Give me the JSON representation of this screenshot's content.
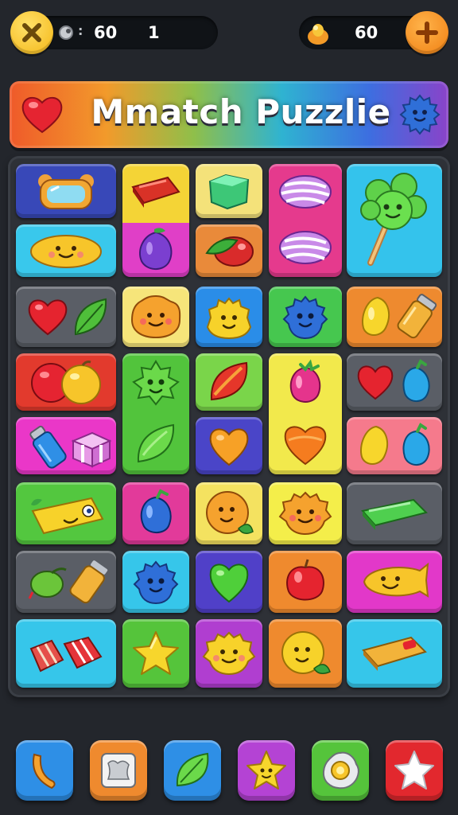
{
  "hud": {
    "left_value": "60",
    "left_sub_value": "1",
    "left_sep": ":",
    "right_value": "60"
  },
  "banner": {
    "title": "Mmatch Puzzlie"
  },
  "colors": {
    "background": "#23262c",
    "board": "#2e3137"
  },
  "tiles": [
    {
      "id": "t1",
      "color": "#3848b8",
      "icon": "mirror-frame-icon"
    },
    {
      "id": "t2",
      "color": "#f4d436",
      "icon": "red-candy-bar-icon"
    },
    {
      "id": "t3",
      "color": "#f4e27a",
      "icon": "green-gummy-block-icon"
    },
    {
      "id": "t4",
      "color": "#e53a8d",
      "icon": "striped-candy-pair-icon"
    },
    {
      "id": "t5",
      "color": "#34c3ec",
      "icon": "green-lollipop-face-icon"
    },
    {
      "id": "t6",
      "color": "#39c8ec",
      "icon": "yellow-smile-blob-icon"
    },
    {
      "id": "t7",
      "color": "#e03fc7",
      "icon": "purple-plum-icon"
    },
    {
      "id": "t8",
      "color": "#e98a3a",
      "icon": "green-red-berry-icon"
    },
    {
      "id": "t9",
      "color": "#5a5e66",
      "icon": "heart-and-leaf-icon"
    },
    {
      "id": "t10",
      "color": "#f6e57a",
      "icon": "orange-face-blob-icon"
    },
    {
      "id": "t11",
      "color": "#2a8de8",
      "icon": "yellow-face-blob-icon"
    },
    {
      "id": "t12",
      "color": "#46c74f",
      "icon": "blue-face-blob-icon"
    },
    {
      "id": "t13",
      "color": "#ee8a2f",
      "icon": "lemon-and-pencil-icon"
    },
    {
      "id": "t14",
      "color": "#e23a2d",
      "icon": "red-and-yellow-balls-icon"
    },
    {
      "id": "t15",
      "color": "#52c43c",
      "icon": "green-smile-blob-and-leaf-icon"
    },
    {
      "id": "t16",
      "color": "#7ad54a",
      "icon": "red-leaf-icon"
    },
    {
      "id": "t17",
      "color": "#f2e94c",
      "icon": "pink-berry-and-orange-heart-icon"
    },
    {
      "id": "t18",
      "color": "#5a5e66",
      "icon": "heart-and-blue-berry-icon"
    },
    {
      "id": "t19",
      "color": "#ea37c8",
      "icon": "glue-and-giftbox-icon"
    },
    {
      "id": "t20",
      "color": "#4a45c8",
      "icon": "orange-heart-icon"
    },
    {
      "id": "t21",
      "color": "#f57a8c",
      "icon": "lemon-and-blue-berry-icon"
    },
    {
      "id": "t22",
      "color": "#53c73f",
      "icon": "cheese-face-icon"
    },
    {
      "id": "t23",
      "color": "#e23a9a",
      "icon": "blue-berry-icon"
    },
    {
      "id": "t24",
      "color": "#f4e260",
      "icon": "orange-ball-face-icon"
    },
    {
      "id": "t25",
      "color": "#f4ee4a",
      "icon": "orange-fluffy-face-icon"
    },
    {
      "id": "t26",
      "color": "#5a5e66",
      "icon": "green-candy-bar-icon"
    },
    {
      "id": "t27",
      "color": "#5a5e66",
      "icon": "olive-and-glue-icon"
    },
    {
      "id": "t28",
      "color": "#36c6ea",
      "icon": "blue-fluffy-face-icon"
    },
    {
      "id": "t29",
      "color": "#5040c8",
      "icon": "green-heart-leaf-icon"
    },
    {
      "id": "t30",
      "color": "#ef8a2e",
      "icon": "red-apple-icon"
    },
    {
      "id": "t31",
      "color": "#e238c9",
      "icon": "yellow-smile-fish-icon"
    },
    {
      "id": "t32",
      "color": "#36c6ea",
      "icon": "striped-candy-pieces-icon"
    },
    {
      "id": "t33",
      "color": "#55c43b",
      "icon": "yellow-star-icon"
    },
    {
      "id": "t34",
      "color": "#b03ed0",
      "icon": "yellow-fluffy-face-icon"
    },
    {
      "id": "t35",
      "color": "#ef8a2e",
      "icon": "yellow-face-with-leaf-icon"
    },
    {
      "id": "t36",
      "color": "#36c6ea",
      "icon": "caramel-bar-icon"
    }
  ],
  "bottom_buttons": [
    {
      "id": "b1",
      "color": "#2e8fe6",
      "icon": "banana-icon"
    },
    {
      "id": "b2",
      "color": "#ef8a2e",
      "icon": "napkin-card-icon"
    },
    {
      "id": "b3",
      "color": "#2e8fe6",
      "icon": "green-leaf-icon"
    },
    {
      "id": "b4",
      "color": "#b443d4",
      "icon": "yellow-star-face-icon"
    },
    {
      "id": "b5",
      "color": "#55c43b",
      "icon": "fried-egg-icon"
    },
    {
      "id": "b6",
      "color": "#e2282e",
      "icon": "white-star-icon"
    }
  ]
}
